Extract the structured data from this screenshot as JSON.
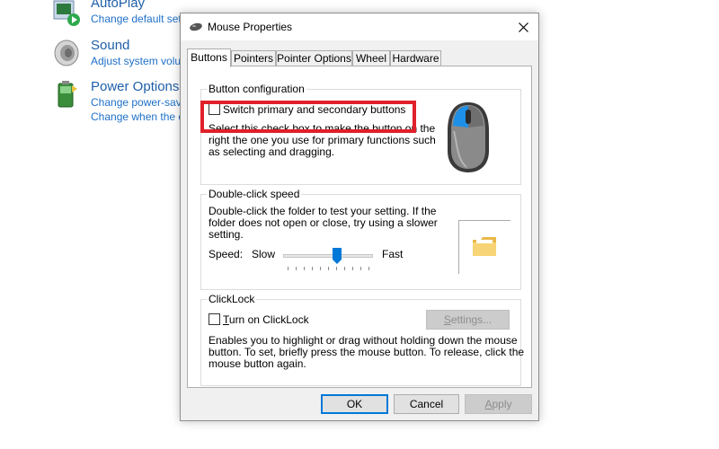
{
  "control_panel": {
    "items": [
      {
        "title": "AutoPlay",
        "links": [
          "Change default settings for media or devices"
        ]
      },
      {
        "title": "Sound",
        "links": [
          "Adjust system volume"
        ]
      },
      {
        "title": "Power Options",
        "links": [
          "Change power-saving settings",
          "Change when the computer sleeps"
        ]
      }
    ]
  },
  "dialog": {
    "title": "Mouse Properties",
    "tabs": [
      "Buttons",
      "Pointers",
      "Pointer Options",
      "Wheel",
      "Hardware"
    ],
    "active_tab": "Buttons",
    "button_config": {
      "label": "Button configuration",
      "checkbox_label": "Switch primary and secondary buttons",
      "checked": false,
      "description": [
        "Select this check box to make the button on the",
        "right the one you use for primary functions such",
        "as selecting and dragging."
      ]
    },
    "double_click": {
      "label": "Double-click speed",
      "description": [
        "Double-click the folder to test your setting. If the",
        "folder does not open or close, try using a slower",
        "setting."
      ],
      "speed_label": "Speed:",
      "slow_label": "Slow",
      "fast_label": "Fast",
      "speed_value": 0.6
    },
    "clicklock": {
      "label": "ClickLock",
      "checkbox_label": "Turn on ClickLock",
      "checked": false,
      "settings_button": "Settings...",
      "description": [
        "Enables you to highlight or drag without holding down the mouse",
        "button. To set, briefly press the mouse button. To release, click the",
        "mouse button again."
      ]
    },
    "buttons": {
      "ok": "OK",
      "cancel": "Cancel",
      "apply": "Apply"
    }
  },
  "colors": {
    "highlight": "#e0202a",
    "mouse_accent": "#1e90e8",
    "link": "#1e70c8"
  }
}
